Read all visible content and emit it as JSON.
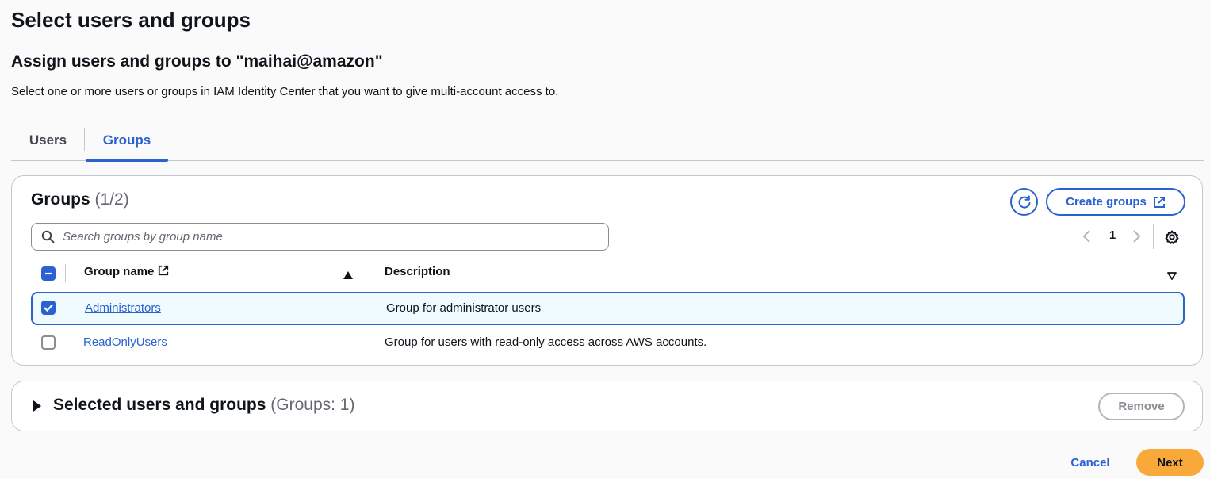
{
  "page": {
    "title": "Select users and groups",
    "section_title": "Assign users and groups to \"maihai@amazon\"",
    "section_description": "Select one or more users or groups in IAM Identity Center that you want to give multi-account access to."
  },
  "tabs": [
    {
      "label": "Users",
      "active": false
    },
    {
      "label": "Groups",
      "active": true
    }
  ],
  "groups_panel": {
    "heading": "Groups",
    "count": "(1/2)",
    "refresh_icon": "refresh-icon",
    "create_button": "Create groups",
    "create_icon": "external-link-icon",
    "search_placeholder": "Search groups by group name",
    "search_value": "",
    "pagination": {
      "current_page": "1"
    },
    "columns": [
      {
        "label": "Group name",
        "sorted": "ascending"
      },
      {
        "label": "Description"
      }
    ],
    "rows": [
      {
        "name": "Administrators",
        "description": "Group for administrator users",
        "selected": true
      },
      {
        "name": "ReadOnlyUsers",
        "description": "Group for users with read-only access across AWS accounts.",
        "selected": false
      }
    ]
  },
  "selected_panel": {
    "heading": "Selected users and groups",
    "count": "(Groups: 1)",
    "remove_button": "Remove"
  },
  "footer": {
    "cancel_button": "Cancel",
    "next_button": "Next"
  },
  "colors": {
    "accent": "#2b61d1",
    "primary_button": "#f8a93a",
    "selected_row_bg": "#f0fbff",
    "border": "#c6c6cd"
  }
}
